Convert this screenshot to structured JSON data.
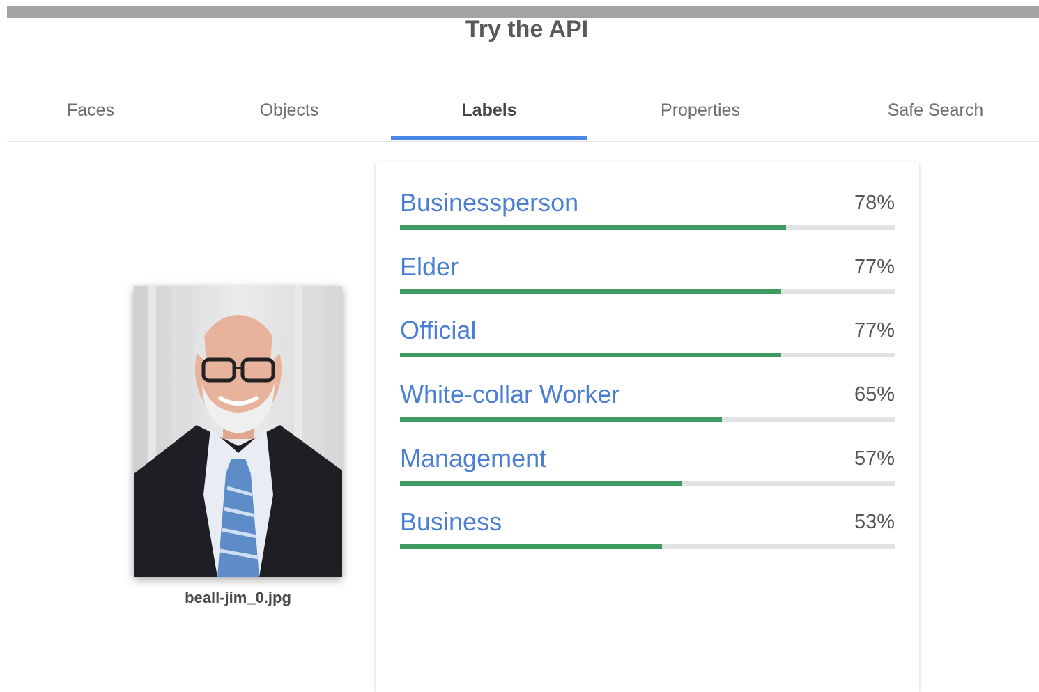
{
  "header": {
    "title": "Try the API"
  },
  "tabs": [
    {
      "label": "Faces",
      "active": false
    },
    {
      "label": "Objects",
      "active": false
    },
    {
      "label": "Labels",
      "active": true
    },
    {
      "label": "Properties",
      "active": false
    },
    {
      "label": "Safe Search",
      "active": false
    }
  ],
  "image": {
    "file_name": "beall-jim_0.jpg"
  },
  "labels": [
    {
      "name": "Businessperson",
      "score": "78%",
      "confidence": 0.78
    },
    {
      "name": "Elder",
      "score": "77%",
      "confidence": 0.77
    },
    {
      "name": "Official",
      "score": "77%",
      "confidence": 0.77
    },
    {
      "name": "White-collar Worker",
      "score": "65%",
      "confidence": 0.65
    },
    {
      "name": "Management",
      "score": "57%",
      "confidence": 0.57
    },
    {
      "name": "Business",
      "score": "53%",
      "confidence": 0.53
    }
  ],
  "colors": {
    "accent_blue": "#4a86e8",
    "label_blue": "#4a7fd4",
    "bar_green": "#3e9b5f",
    "bar_track": "#e2e2e2"
  }
}
